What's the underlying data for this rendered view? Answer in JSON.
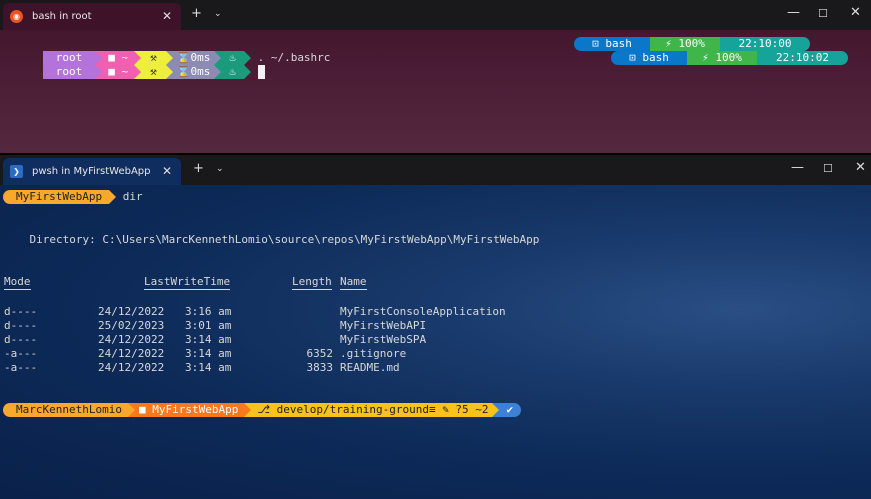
{
  "colors": {
    "root_bg": "#b373db",
    "folder_bg": "#f05fb0",
    "git_bg": "#eeee3c",
    "exec_bg": "#8b8bb4",
    "node_bg": "#1a9c7c",
    "shell_bg": "#0a77c8",
    "battery_bg": "#3fb54a",
    "time_bg": "#16a39a",
    "pwsh_user_bg": "#f8a92d",
    "pwsh_path_bg": "#f6791f",
    "pwsh_git_bg": "#f8c21e",
    "pwsh_status_bg": "#3b82d6"
  },
  "bash_window": {
    "tab_title": "bash in root",
    "tab_icon": "ubuntu-icon",
    "prompt1": {
      "user": "root",
      "folder": "~",
      "git": "",
      "exec_time": "0ms",
      "command": ". ~/.bashrc"
    },
    "prompt2": {
      "user": "root",
      "folder": "~",
      "git": "",
      "exec_time": "0ms",
      "command": ""
    },
    "right_prompt1": {
      "shell": "bash",
      "battery": "100%",
      "time": "22:10:00"
    },
    "right_prompt2": {
      "shell": "bash",
      "battery": "100%",
      "time": "22:10:02"
    }
  },
  "pwsh_window": {
    "tab_title": "pwsh in MyFirstWebApp",
    "tab_icon": "powershell-icon",
    "prompt_dir": "MyFirstWebApp",
    "command": "dir",
    "directory_line": "    Directory: C:\\Users\\MarcKennethLomio\\source\\repos\\MyFirstWebApp\\MyFirstWebApp",
    "headers": {
      "mode": "Mode",
      "lastwrite": "LastWriteTime",
      "length": "Length",
      "name": "Name"
    },
    "rows": [
      {
        "mode": "d----",
        "date": "24/12/2022",
        "time": "3:16 am",
        "length": "",
        "name": "MyFirstConsoleApplication"
      },
      {
        "mode": "d----",
        "date": "25/02/2023",
        "time": "3:01 am",
        "length": "",
        "name": "MyFirstWebAPI"
      },
      {
        "mode": "d----",
        "date": "24/12/2022",
        "time": "3:14 am",
        "length": "",
        "name": "MyFirstWebSPA"
      },
      {
        "mode": "-a---",
        "date": "24/12/2022",
        "time": "3:14 am",
        "length": "6352",
        "name": ".gitignore"
      },
      {
        "mode": "-a---",
        "date": "24/12/2022",
        "time": "3:14 am",
        "length": "3833",
        "name": "README.md"
      }
    ],
    "final_prompt": {
      "user": "MarcKennethLomio",
      "path": "MyFirstWebApp",
      "git": "develop/training-ground≡ ✎ ?5 ~2",
      "status": "✔"
    }
  }
}
